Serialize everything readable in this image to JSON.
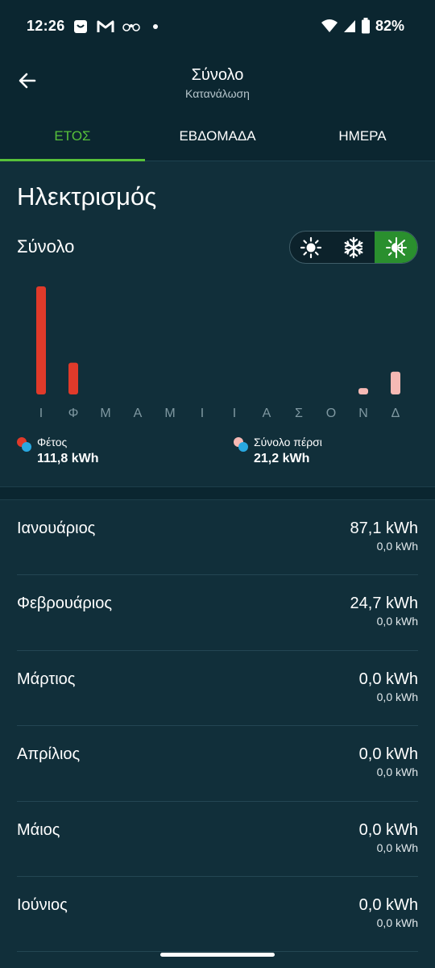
{
  "status_bar": {
    "time": "12:26",
    "battery": "82%",
    "notification_icons": [
      "shopping-bag-icon",
      "gmail-icon",
      "tripadvisor-icon",
      "more-dot"
    ],
    "system_icons": [
      "wifi-icon",
      "signal-icon",
      "battery-icon"
    ]
  },
  "header": {
    "title": "Σύνολο",
    "subtitle": "Κατανάλωση"
  },
  "tabs": [
    {
      "label": "ΕΤΟΣ",
      "active": true
    },
    {
      "label": "ΕΒΔΟΜΑΔΑ",
      "active": false
    },
    {
      "label": "ΗΜΕΡΑ",
      "active": false
    }
  ],
  "section_title": "Ηλεκτρισμός",
  "subsection_title": "Σύνολο",
  "mode_toggle": {
    "options": [
      "sun-icon",
      "snowflake-icon",
      "sun-snowflake-icon"
    ],
    "selected": 2
  },
  "colors": {
    "accent": "#57c13a",
    "this_year_bar": "#e03a2a",
    "last_year_bar": "#f6b9b4",
    "background": "#112f3a",
    "header": "#0b2630"
  },
  "chart_data": {
    "type": "bar",
    "categories": [
      "Ι",
      "Φ",
      "Μ",
      "Α",
      "Μ",
      "Ι",
      "Ι",
      "Α",
      "Σ",
      "Ο",
      "Ν",
      "Δ"
    ],
    "series": [
      {
        "name": "Φέτος",
        "values": [
          87.1,
          24.7,
          0,
          0,
          0,
          0,
          0,
          0,
          0,
          0,
          0,
          0
        ]
      },
      {
        "name": "Σύνολο πέρσι",
        "values": [
          0,
          0,
          0,
          0,
          0,
          0,
          0,
          0,
          0,
          0,
          3.9,
          17.3
        ]
      }
    ],
    "ylim": [
      0,
      87.1
    ],
    "grid": false
  },
  "legend": [
    {
      "label": "Φέτος",
      "value": "111,8 kWh"
    },
    {
      "label": "Σύνολο πέρσι",
      "value": "21,2 kWh"
    }
  ],
  "months": [
    {
      "name": "Ιανουάριος",
      "value": "87,1 kWh",
      "previous": "0,0 kWh"
    },
    {
      "name": "Φεβρουάριος",
      "value": "24,7 kWh",
      "previous": "0,0 kWh"
    },
    {
      "name": "Μάρτιος",
      "value": "0,0 kWh",
      "previous": "0,0 kWh"
    },
    {
      "name": "Απρίλιος",
      "value": "0,0 kWh",
      "previous": "0,0 kWh"
    },
    {
      "name": "Μάιος",
      "value": "0,0 kWh",
      "previous": "0,0 kWh"
    },
    {
      "name": "Ιούνιος",
      "value": "0,0 kWh",
      "previous": "0,0 kWh"
    }
  ]
}
